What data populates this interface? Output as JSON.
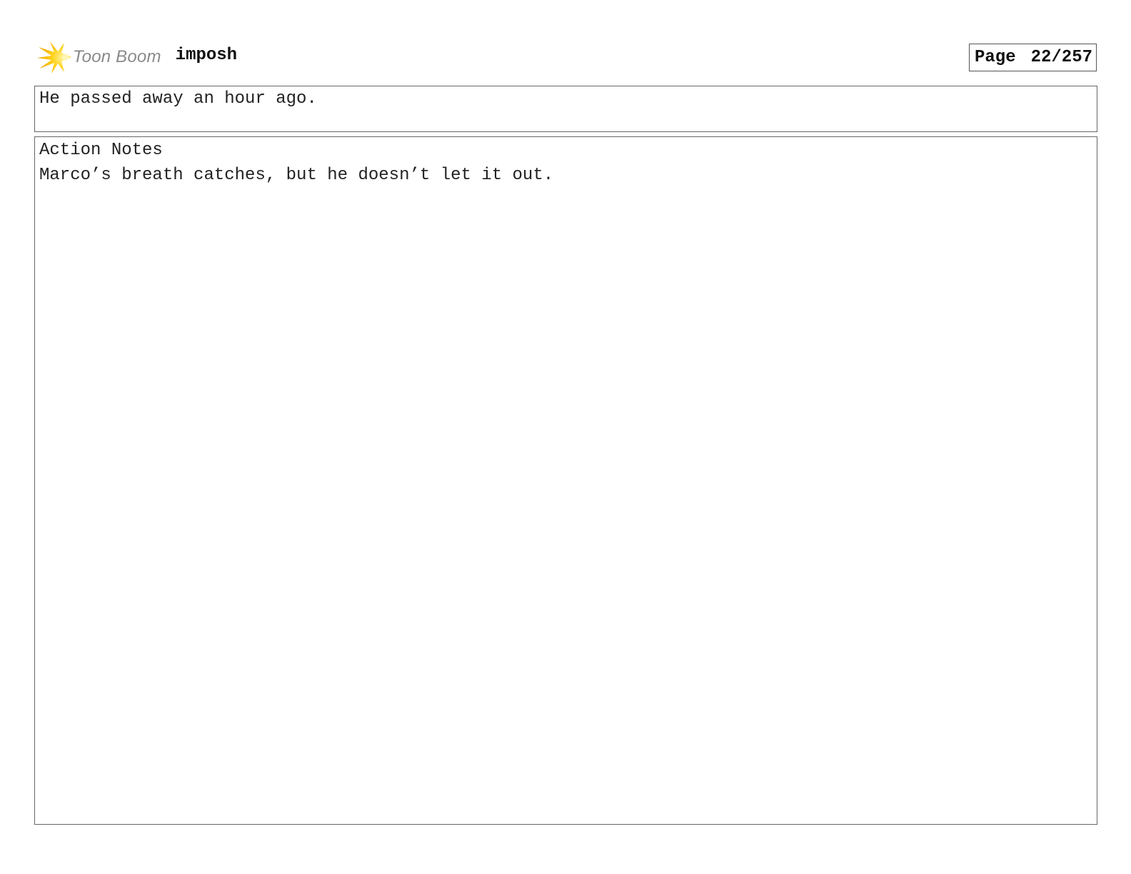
{
  "header": {
    "logo_icon": "toon-boom-star-icon",
    "brand_name": "Toon Boom",
    "project_title": "imposh",
    "page_label": "Page",
    "page_number": "22/257",
    "brand_color": "#f5c400"
  },
  "dialogue": {
    "text": "He passed away an hour ago."
  },
  "action_notes": {
    "label": "Action Notes",
    "text": "Marco’s breath catches, but he doesn’t let it out."
  }
}
